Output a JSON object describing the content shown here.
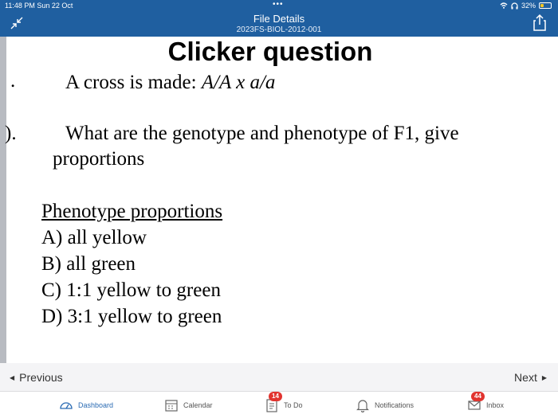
{
  "status": {
    "time": "11:48 PM  Sun 22 Oct",
    "battery": "32%",
    "battery_level": 0.32
  },
  "header": {
    "title": "File Details",
    "subtitle": "2023FS-BIOL-2012-001"
  },
  "slide": {
    "title": "Clicker question",
    "q1_marker": ".",
    "q1_text": "A cross is made: ",
    "q1_cross": "A/A x a/a",
    "q2_marker": ").",
    "q2_line1": "What are the genotype and phenotype of F1, give",
    "q2_line2": "proportions",
    "phen_heading": "Phenotype proportions",
    "options": [
      "A) all yellow",
      "B) all green",
      "C) 1:1 yellow to green",
      "D) 3:1 yellow to green"
    ]
  },
  "nav": {
    "previous": "Previous",
    "next": "Next"
  },
  "tabs": {
    "dashboard": "Dashboard",
    "calendar": "Calendar",
    "todo": "To Do",
    "todo_badge": "14",
    "notifications": "Notifications",
    "inbox": "Inbox",
    "inbox_badge": "44"
  },
  "colors": {
    "header_bg": "#1f5fa0",
    "active_tab": "#2a6bb3",
    "badge": "#e1342f"
  }
}
